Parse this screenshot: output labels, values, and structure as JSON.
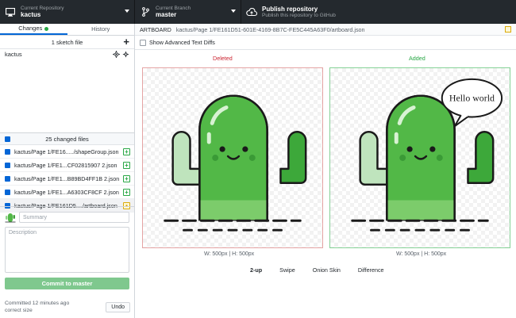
{
  "toolbar": {
    "repo_label": "Current Repository",
    "repo_name": "kactus",
    "branch_label": "Current Branch",
    "branch_name": "master",
    "publish_title": "Publish repository",
    "publish_sub": "Publish this repository to GitHub"
  },
  "tabs": {
    "changes": "Changes",
    "history": "History"
  },
  "sketch": {
    "header": "1 sketch file",
    "file": "kactus"
  },
  "changes": {
    "header": "25 changed files",
    "files": [
      {
        "path": "kactus/Page 1/FE16...../shapeGroup.json",
        "status": "added"
      },
      {
        "path": "kactus/Page 1/FE1...CF02815907 2.json",
        "status": "added"
      },
      {
        "path": "kactus/Page 1/FE1...B89BD4FF1B 2.json",
        "status": "added"
      },
      {
        "path": "kactus/Page 1/FE1...A6303CF8CF 2.json",
        "status": "added"
      },
      {
        "path": "kactus/Page 1/FE161D5..../artboard.json",
        "status": "modified"
      }
    ]
  },
  "commit": {
    "summary_placeholder": "Summary",
    "description_placeholder": "Description",
    "button": "Commit to master",
    "last_line1": "Committed 12 minutes ago",
    "last_line2": "correct size",
    "undo": "Undo"
  },
  "diff": {
    "label": "ARTBOARD",
    "path": "kactus/Page 1/FE161D51-601E-4169-8B7C-FE5C445A63F0/artboard.json",
    "advanced_option": "Show Advanced Text Diffs",
    "deleted_label": "Deleted",
    "added_label": "Added",
    "speech_bubble": "Hello world",
    "deleted_dims": "W: 500px | H: 500px",
    "added_dims": "W: 500px | H: 500px",
    "modes": [
      "2-up",
      "Swipe",
      "Onion Skin",
      "Difference"
    ]
  },
  "colors": {
    "toolbar_bg": "#24292e",
    "deleted": "#cb2431",
    "added": "#28a745",
    "cactus_green": "#52b847",
    "commit_button": "#7fc88e"
  },
  "icons": [
    "monitor-icon",
    "branch-icon",
    "cloud-upload-icon",
    "plus-icon",
    "sketch-diamond-icon",
    "checkbox-icon",
    "file-added-icon",
    "file-modified-icon",
    "avatar-icon"
  ]
}
